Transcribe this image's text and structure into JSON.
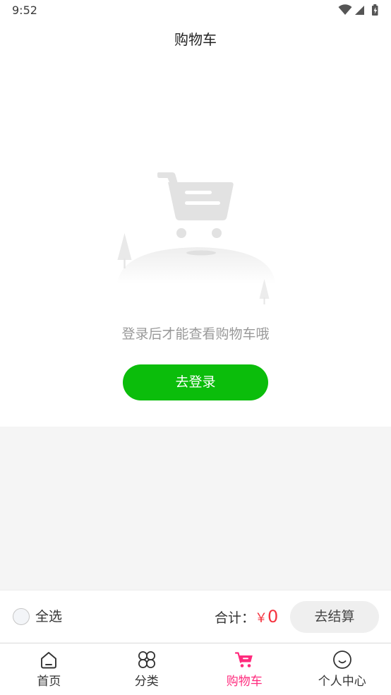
{
  "status_bar": {
    "time": "9:52",
    "icons": {
      "wifi": "wifi-icon",
      "signal": "signal-icon",
      "battery": "battery-icon"
    }
  },
  "header": {
    "title": "购物车"
  },
  "empty_state": {
    "illustration": "empty-cart-illustration",
    "message": "登录后才能查看购物车哦",
    "login_button_label": "去登录"
  },
  "checkout_bar": {
    "select_all_label": "全选",
    "select_all_checked": false,
    "total_label": "合计：",
    "currency_symbol": "￥",
    "total_amount": "0",
    "checkout_button_label": "去结算"
  },
  "tab_bar": {
    "active_index": 2,
    "tabs": [
      {
        "label": "首页",
        "icon": "home-icon"
      },
      {
        "label": "分类",
        "icon": "category-icon"
      },
      {
        "label": "购物车",
        "icon": "cart-icon"
      },
      {
        "label": "个人中心",
        "icon": "smile-icon"
      }
    ]
  },
  "colors": {
    "accent": "#ff2b7d",
    "login_button": "#0bbd0b",
    "price": "#f5333f",
    "checkout_button_bg": "#efefef",
    "page_bg": "#f5f5f5",
    "muted_text": "#999999"
  }
}
